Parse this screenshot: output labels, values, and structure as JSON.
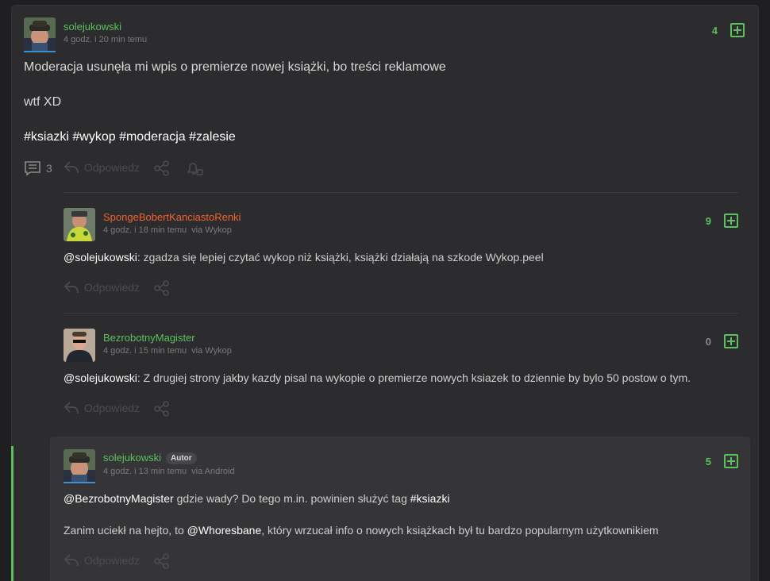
{
  "post": {
    "author": "solejukowski",
    "author_color": "#5ac15e",
    "time": "4 godz. i 20 min temu",
    "votes": "4",
    "lines": [
      "Moderacja usunęła mi wpis o premierze nowej książki, bo treści reklamowe",
      "wtf XD"
    ],
    "tags": [
      "#ksiazki",
      "#wykop",
      "#moderacja",
      "#zalesie"
    ],
    "comment_count": "3",
    "reply_label": "Odpowiedz"
  },
  "comments": [
    {
      "author": "SpongeBobertKanciastoRenki",
      "author_color": "#f0622d",
      "time": "4 godz. i 18 min temu",
      "via": "via Wykop",
      "votes": "9",
      "mention": "@solejukowski",
      "text": ": zgadza się lepiej czytać wykop niż książki, książki działają na szkode Wykop.peel",
      "reply_label": "Odpowiedz"
    },
    {
      "author": "BezrobotnyMagister",
      "author_color": "#5ac15e",
      "time": "4 godz. i 15 min temu",
      "via": "via Wykop",
      "votes": "0",
      "mention": "@solejukowski",
      "text": ": Z drugiej strony jakby kazdy pisal na wykopie o premierze nowych ksiazek to dziennie by bylo 50 postow o tym.",
      "reply_label": "Odpowiedz"
    },
    {
      "author": "solejukowski",
      "author_color": "#5ac15e",
      "badge": "Autor",
      "time": "4 godz. i 13 min temu",
      "via": "via Android",
      "votes": "5",
      "mention": "@BezrobotnyMagister",
      "text1": " gdzie wady? Do tego m.in. powinien służyć tag ",
      "tag": "#ksiazki",
      "text2a": "Zanim uciekł na hejto, to ",
      "mention2": "@Whoresbane",
      "text2b": ", który wrzucał info o nowych książkach był tu bardzo popularnym użytkownikiem",
      "reply_label": "Odpowiedz"
    }
  ],
  "colors": {
    "accent_green": "#5ac15e",
    "accent_orange": "#f0622d",
    "background": "#1f1f21",
    "card": "#2c2c2e"
  },
  "icons": [
    "avatar",
    "comments-icon",
    "reply-icon",
    "share-icon",
    "bell-icon",
    "plus-vote-icon"
  ]
}
